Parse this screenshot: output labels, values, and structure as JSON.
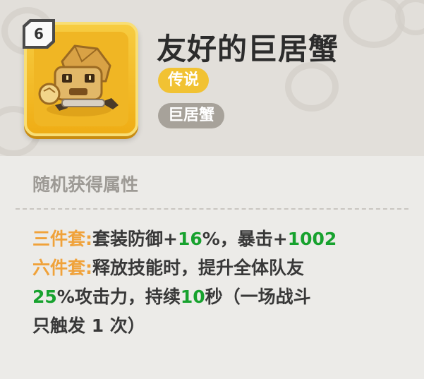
{
  "item": {
    "level": "6",
    "name": "友好的巨居蟹",
    "rarity": "传说",
    "category": "巨居蟹",
    "icon": "rock-crab-icon"
  },
  "attributes": {
    "section_title": "随机获得属性",
    "lines": [
      [
        {
          "t": "三件套:",
          "c": "k"
        },
        {
          "t": "套装防御+",
          "c": "n"
        },
        {
          "t": "16",
          "c": "g"
        },
        {
          "t": "%，暴击+",
          "c": "n"
        },
        {
          "t": "1002",
          "c": "g"
        }
      ],
      [
        {
          "t": "六件套:",
          "c": "k"
        },
        {
          "t": "释放技能时，提升全体队友",
          "c": "n"
        }
      ],
      [
        {
          "t": "25",
          "c": "g"
        },
        {
          "t": "%攻击力，持续",
          "c": "n"
        },
        {
          "t": "10",
          "c": "g"
        },
        {
          "t": "秒（一场战斗",
          "c": "n"
        }
      ],
      [
        {
          "t": "只触发 1 次）",
          "c": "n"
        }
      ]
    ]
  },
  "colors": {
    "key_label": "#f0a23a",
    "value_green": "#17a22e",
    "rarity_badge": "#f1c233",
    "category_badge": "#a7a29a",
    "icon_frame": "#f0b624"
  }
}
